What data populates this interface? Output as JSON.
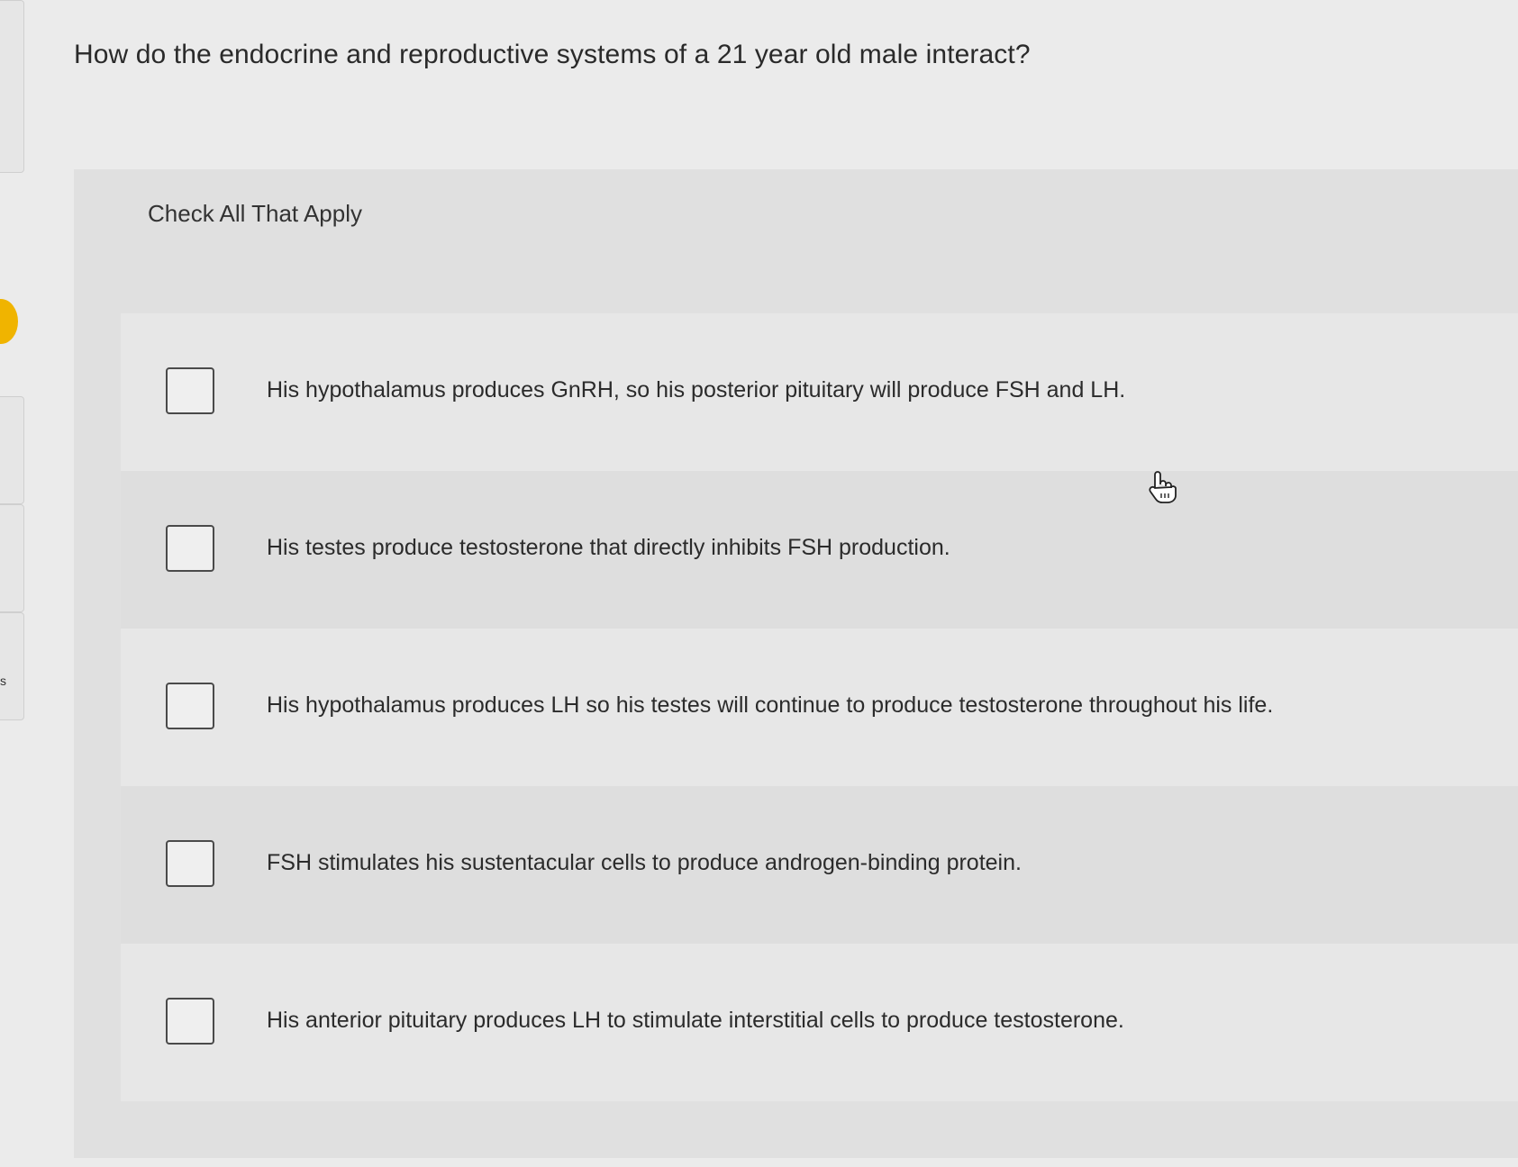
{
  "question": {
    "text": "How do the endocrine and reproductive systems of a 21 year old male interact?"
  },
  "instruction": "Check All That Apply",
  "choices": [
    {
      "label": "His hypothalamus produces GnRH, so his posterior pituitary will produce FSH and LH.",
      "checked": false
    },
    {
      "label": "His testes produce testosterone that directly inhibits FSH production.",
      "checked": false
    },
    {
      "label": "His hypothalamus produces LH so his testes will continue to produce testosterone throughout his life.",
      "checked": false
    },
    {
      "label": "FSH stimulates his sustentacular cells to produce androgen-binding protein.",
      "checked": false
    },
    {
      "label": "His anterior pituitary produces LH to stimulate interstitial cells to produce testosterone.",
      "checked": false
    }
  ],
  "left_rail": {
    "visible_letter": "s",
    "marker_color": "#f0b400"
  },
  "icons": {
    "cursor": "hand-pointer-icon"
  }
}
